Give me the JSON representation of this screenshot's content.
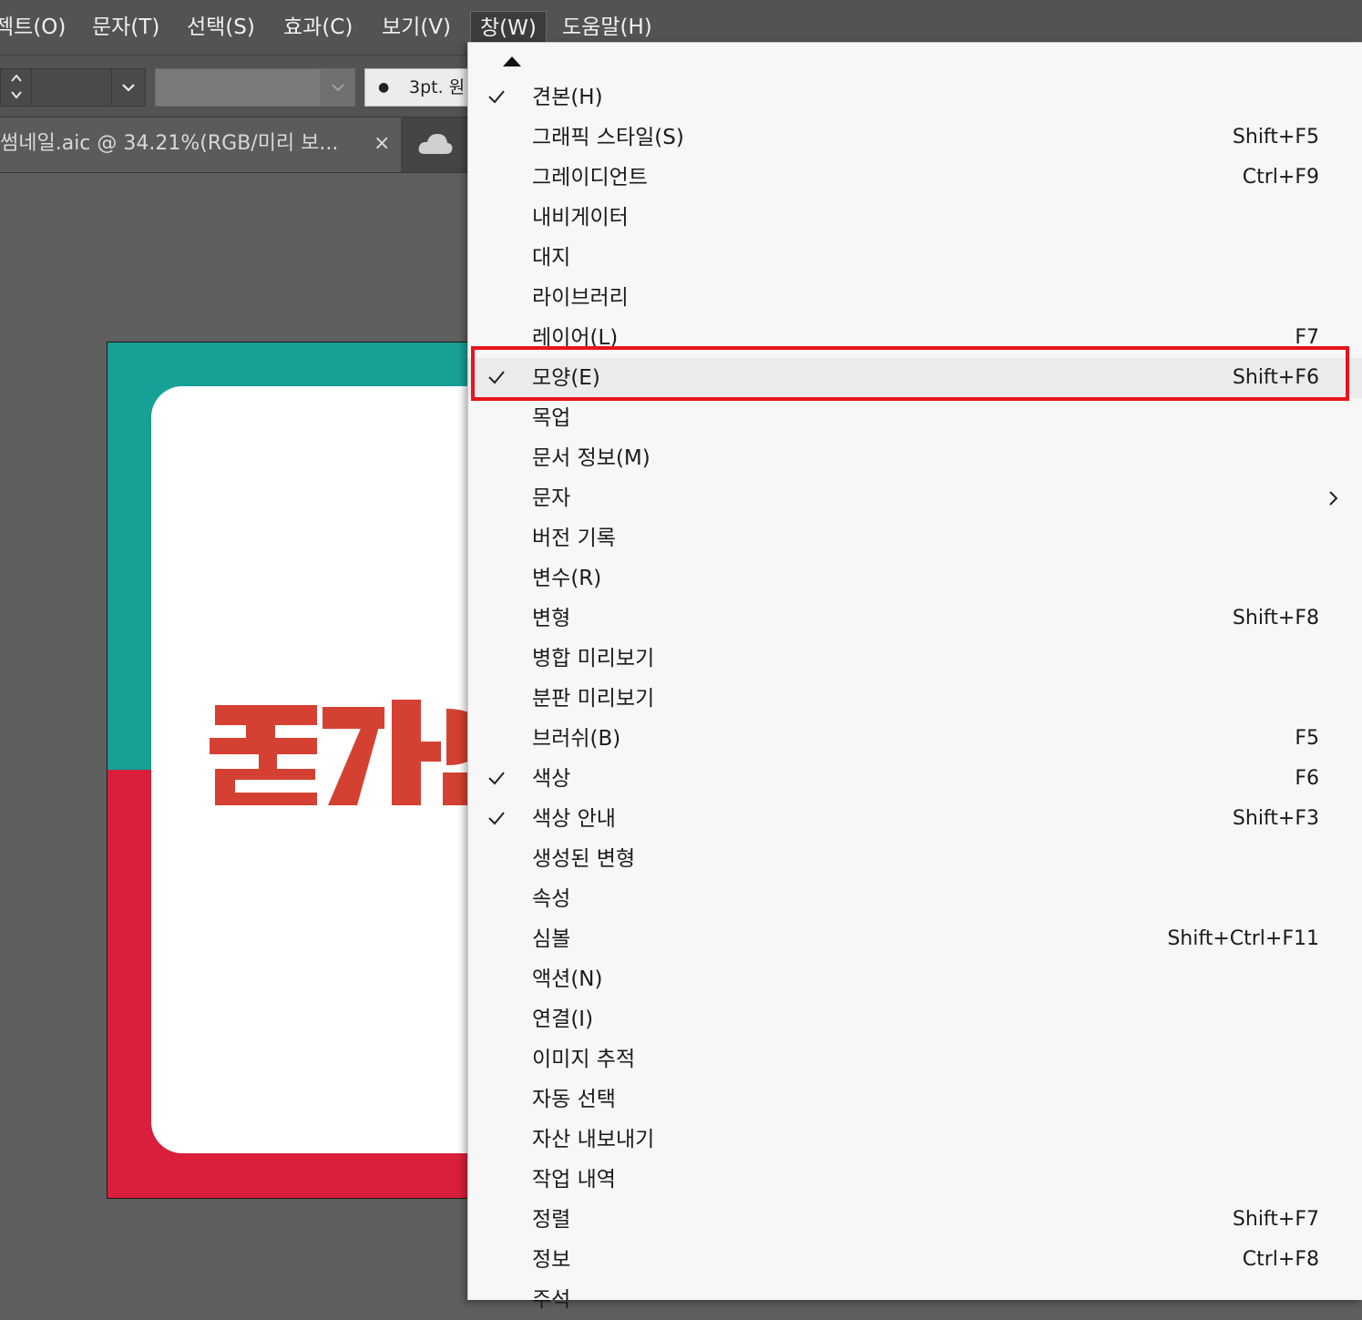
{
  "menubar": {
    "items": [
      "젝트(O)",
      "문자(T)",
      "선택(S)",
      "효과(C)",
      "보기(V)",
      "창(W)",
      "도움말(H)"
    ]
  },
  "controlbar": {
    "stroke_size": "3pt. 원"
  },
  "document_tab": {
    "title": "썸네일.aic  @  34.21%(RGB/미리 보...",
    "close": "×"
  },
  "artboard": {
    "colors": {
      "teal": "#17a096",
      "red": "#d91f3c",
      "logo": "#d44132",
      "card": "#ffffff"
    }
  },
  "window_menu": {
    "items": [
      {
        "label": "견본(H)",
        "shortcut": "",
        "checked": true
      },
      {
        "label": "그래픽 스타일(S)",
        "shortcut": "Shift+F5",
        "checked": false
      },
      {
        "label": "그레이디언트",
        "shortcut": "Ctrl+F9",
        "checked": false
      },
      {
        "label": "내비게이터",
        "shortcut": "",
        "checked": false
      },
      {
        "label": "대지",
        "shortcut": "",
        "checked": false
      },
      {
        "label": "라이브러리",
        "shortcut": "",
        "checked": false
      },
      {
        "label": "레이어(L)",
        "shortcut": "F7",
        "checked": false
      },
      {
        "label": "모양(E)",
        "shortcut": "Shift+F6",
        "checked": true,
        "highlighted": true
      },
      {
        "label": "목업",
        "shortcut": "",
        "checked": false
      },
      {
        "label": "문서 정보(M)",
        "shortcut": "",
        "checked": false
      },
      {
        "label": "문자",
        "shortcut": "",
        "checked": false,
        "submenu": true
      },
      {
        "label": "버전 기록",
        "shortcut": "",
        "checked": false
      },
      {
        "label": "변수(R)",
        "shortcut": "",
        "checked": false
      },
      {
        "label": "변형",
        "shortcut": "Shift+F8",
        "checked": false
      },
      {
        "label": "병합 미리보기",
        "shortcut": "",
        "checked": false
      },
      {
        "label": "분판 미리보기",
        "shortcut": "",
        "checked": false
      },
      {
        "label": "브러쉬(B)",
        "shortcut": "F5",
        "checked": false
      },
      {
        "label": "색상",
        "shortcut": "F6",
        "checked": true
      },
      {
        "label": "색상 안내",
        "shortcut": "Shift+F3",
        "checked": true
      },
      {
        "label": "생성된 변형",
        "shortcut": "",
        "checked": false
      },
      {
        "label": "속성",
        "shortcut": "",
        "checked": false
      },
      {
        "label": "심볼",
        "shortcut": "Shift+Ctrl+F11",
        "checked": false
      },
      {
        "label": "액션(N)",
        "shortcut": "",
        "checked": false
      },
      {
        "label": "연결(I)",
        "shortcut": "",
        "checked": false
      },
      {
        "label": "이미지 추적",
        "shortcut": "",
        "checked": false
      },
      {
        "label": "자동 선택",
        "shortcut": "",
        "checked": false
      },
      {
        "label": "자산 내보내기",
        "shortcut": "",
        "checked": false
      },
      {
        "label": "작업 내역",
        "shortcut": "",
        "checked": false
      },
      {
        "label": "정렬",
        "shortcut": "Shift+F7",
        "checked": false
      },
      {
        "label": "정보",
        "shortcut": "Ctrl+F8",
        "checked": false
      },
      {
        "label": "주석",
        "shortcut": "",
        "checked": false
      }
    ]
  },
  "icons": {
    "check": "check-icon",
    "submenu": "chevron-right-icon",
    "scroll_up": "triangle-up-icon",
    "cloud": "cloud-icon"
  }
}
